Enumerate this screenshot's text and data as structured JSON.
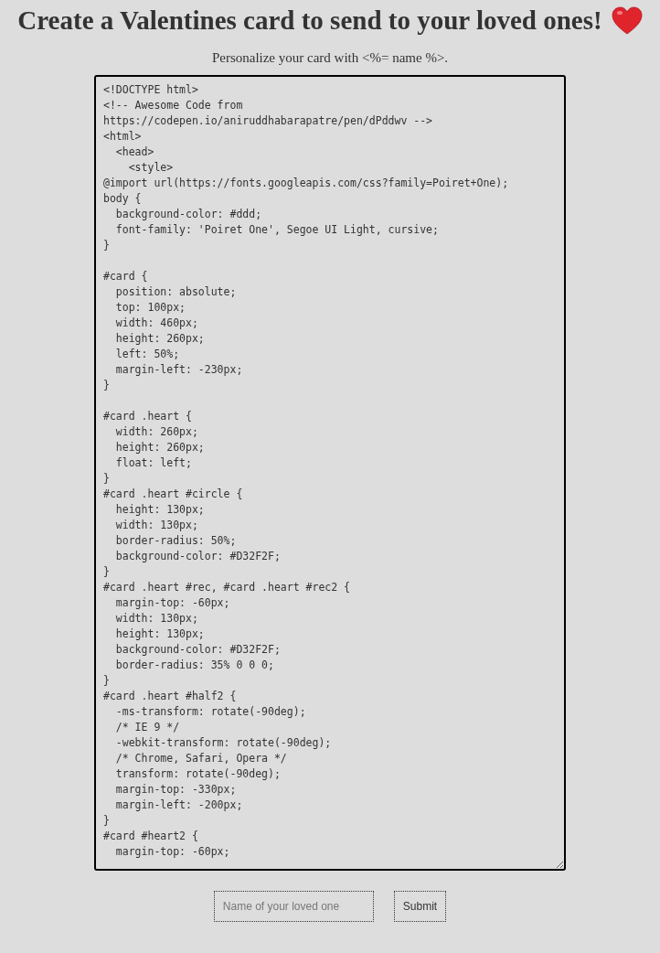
{
  "heading": {
    "title": "Create a Valentines card to send to your loved ones!"
  },
  "subtitle": "Personalize your card with <%= name %>.",
  "code_editor": {
    "value": "<!DOCTYPE html>\n<!-- Awesome Code from\nhttps://codepen.io/aniruddhabarapatre/pen/dPddwv -->\n<html>\n  <head>\n    <style>\n@import url(https://fonts.googleapis.com/css?family=Poiret+One);\nbody {\n  background-color: #ddd;\n  font-family: 'Poiret One', Segoe UI Light, cursive;\n}\n\n#card {\n  position: absolute;\n  top: 100px;\n  width: 460px;\n  height: 260px;\n  left: 50%;\n  margin-left: -230px;\n}\n\n#card .heart {\n  width: 260px;\n  height: 260px;\n  float: left;\n}\n#card .heart #circle {\n  height: 130px;\n  width: 130px;\n  border-radius: 50%;\n  background-color: #D32F2F;\n}\n#card .heart #rec, #card .heart #rec2 {\n  margin-top: -60px;\n  width: 130px;\n  height: 130px;\n  background-color: #D32F2F;\n  border-radius: 35% 0 0 0;\n}\n#card .heart #half2 {\n  -ms-transform: rotate(-90deg);\n  /* IE 9 */\n  -webkit-transform: rotate(-90deg);\n  /* Chrome, Safari, Opera */\n  transform: rotate(-90deg);\n  margin-top: -330px;\n  margin-left: -200px;\n}\n#card #heart2 {\n  margin-top: -60px;"
  },
  "form": {
    "name_field": {
      "placeholder": "Name of your loved one"
    },
    "submit_button": "Submit"
  }
}
